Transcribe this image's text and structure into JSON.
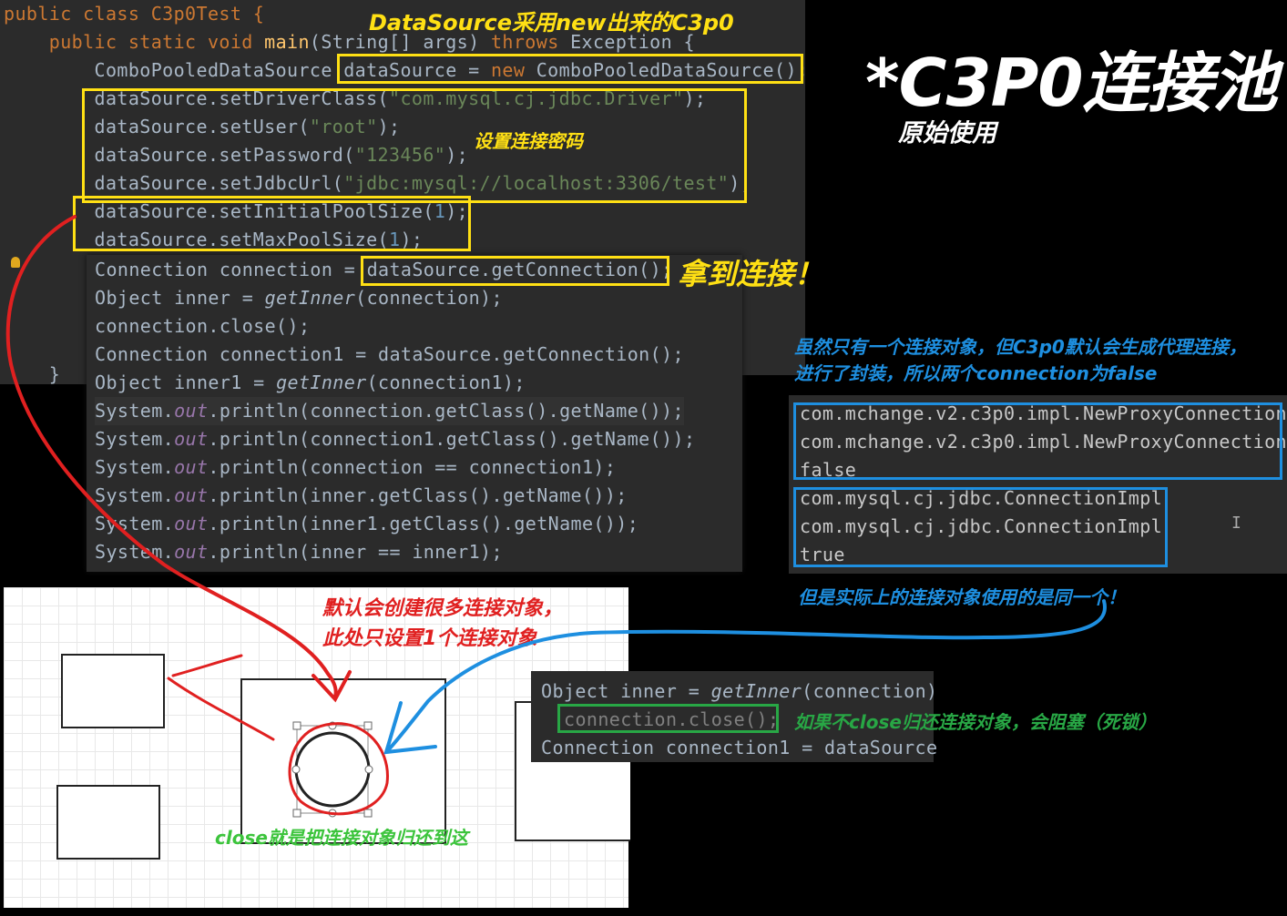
{
  "title": "*C3P0连接池",
  "subtitle": "原始使用",
  "code_top": {
    "l1": "public class C3p0Test {",
    "l2a": "    public static void ",
    "l2b": "main",
    "l2c": "(String[] args) ",
    "l2d": "throws",
    "l2e": " Exception {",
    "l3a": "        ComboPooledDataSource ",
    "l3b": "dataSource = ",
    "l3c": "new",
    "l3d": " ComboPooledDataSource();",
    "l4a": "        dataSource.setDriverClass(",
    "l4b": "\"com.mysql.cj.jdbc.Driver\"",
    "l4c": ");",
    "l5a": "        dataSource.setUser(",
    "l5b": "\"root\"",
    "l5c": ");",
    "l6a": "        dataSource.setPassword(",
    "l6b": "\"123456\"",
    "l6c": ");",
    "l7a": "        dataSource.setJdbcUrl(",
    "l7b": "\"jdbc:mysql://localhost:3306/test\"",
    "l7c": ");",
    "l8a": "        dataSource.setInitialPoolSize(",
    "l8b": "1",
    "l8c": ");",
    "l9a": "        dataSource.setMaxPoolSize(",
    "l9b": "1",
    "l9c": ");",
    "l10": "    }"
  },
  "code_mid": {
    "m1a": "Connection connection = ",
    "m1b": "dataSource.getConnection();",
    "m2a": "Object inner = ",
    "m2b": "getInner",
    "m2c": "(connection);",
    "m3": "connection.close();",
    "m4": "Connection connection1 = dataSource.getConnection();",
    "m5a": "Object inner1 = ",
    "m5b": "getInner",
    "m5c": "(connection1);",
    "sys": "System.",
    "out": "out",
    "m6": ".println(connection.getClass().getName());",
    "m7": ".println(connection1.getClass().getName());",
    "m8": ".println(connection == connection1);",
    "m9": ".println(inner.getClass().getName());",
    "m10": ".println(inner1.getClass().getName());",
    "m11": ".println(inner == inner1);"
  },
  "output": {
    "o1": "com.mchange.v2.c3p0.impl.NewProxyConnection",
    "o2": "com.mchange.v2.c3p0.impl.NewProxyConnection",
    "o3": "false",
    "o4": "com.mysql.cj.jdbc.ConnectionImpl",
    "o5": "com.mysql.cj.jdbc.ConnectionImpl",
    "o6": "true"
  },
  "code_small": {
    "s1a": "Object inner = ",
    "s1b": "getInner",
    "s1c": "(connection)",
    "s2": "connection.close();",
    "s3": "Connection connection1 = dataSource"
  },
  "notes": {
    "datasource_new": "DataSource采用new出来的C3p0",
    "set_password": "设置连接密码",
    "get_conn": "拿到连接！",
    "proxy_1": "虽然只有一个连接对象，但C3p0默认会生成代理连接，",
    "proxy_2": "进行了封装，所以两个connection为false",
    "same": "但是实际上的连接对象使用的是同一个！",
    "default_many_1": "默认会创建很多连接对象，",
    "default_many_2": "此处只设置1个连接对象",
    "no_close": "如果不close归还连接对象，会阻塞（死锁）",
    "close_return": "close就是把连接对象归还到这"
  },
  "colors": {
    "yellow": "#ffe014",
    "blue": "#1e8fe0",
    "green": "#28a745",
    "red": "#e02020",
    "editor_bg": "#2b2b2b"
  }
}
